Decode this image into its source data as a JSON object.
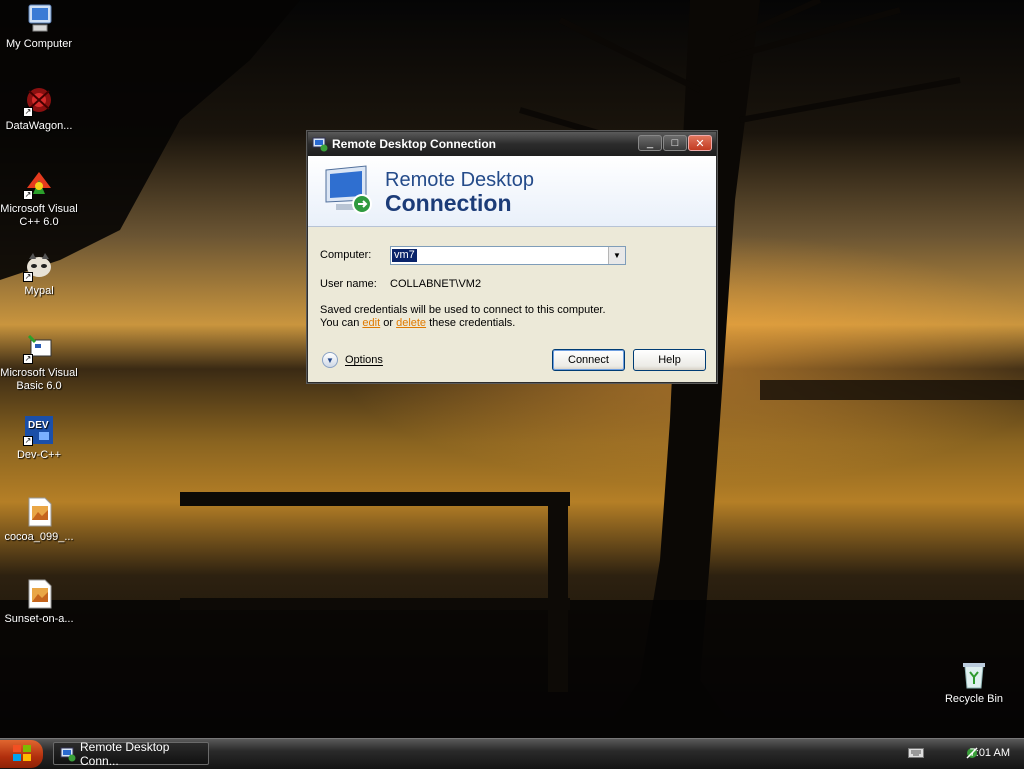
{
  "desktop": {
    "icons": [
      {
        "label": "My Computer",
        "icon": "my-computer-icon"
      },
      {
        "label": "DataWagon...",
        "icon": "datawagon-icon"
      },
      {
        "label": "Microsoft Visual C++ 6.0",
        "icon": "visual-cpp-icon"
      },
      {
        "label": "Mypal",
        "icon": "mypal-icon"
      },
      {
        "label": "Microsoft Visual Basic 6.0",
        "icon": "visual-basic-icon"
      },
      {
        "label": "Dev-C++",
        "icon": "dev-cpp-icon"
      },
      {
        "label": "cocoa_099_...",
        "icon": "image-file-icon"
      },
      {
        "label": "Sunset-on-a...",
        "icon": "image-file-icon"
      }
    ],
    "recycle_bin": {
      "label": "Recycle Bin",
      "icon": "recycle-bin-icon"
    }
  },
  "dialog": {
    "title": "Remote Desktop Connection",
    "banner_line1": "Remote Desktop",
    "banner_line2": "Connection",
    "computer_label": "Computer:",
    "computer_value": "vm7",
    "username_label": "User name:",
    "username_value": "COLLABNET\\VM2",
    "saved_line1": "Saved credentials will be used to connect to this computer.",
    "saved_prefix": "You can ",
    "edit_link": "edit",
    "saved_middle": " or ",
    "delete_link": "delete",
    "saved_suffix": " these credentials.",
    "options_label": "Options",
    "connect_label": "Connect",
    "help_label": "Help",
    "min_glyph": "_",
    "max_glyph": "□",
    "close_glyph": "✕"
  },
  "taskbar": {
    "task_label": "Remote Desktop Conn...",
    "clock": "7:01 AM"
  }
}
